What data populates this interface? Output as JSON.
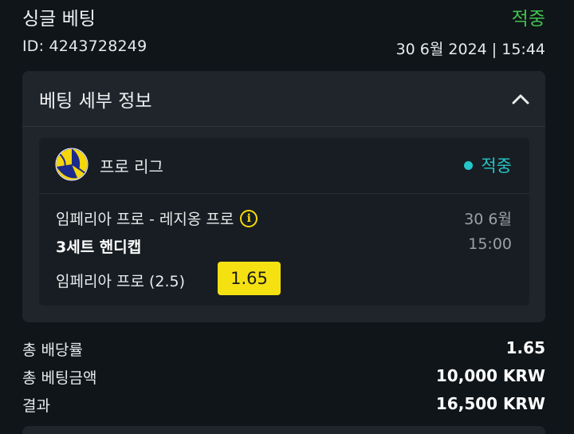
{
  "header": {
    "title": "싱글 베팅",
    "status": "적중",
    "bet_id": "ID: 4243728249",
    "datetime": "30 6월 2024 | 15:44"
  },
  "details": {
    "section_title": "베팅 세부 정보",
    "league": "프로 리그",
    "league_icon": "volleyball-icon",
    "status": "적중",
    "match": "임페리아 프로 - 레지옹 프로",
    "match_date": "30 6월",
    "market": "3세트 핸디캡",
    "match_time": "15:00",
    "selection": "임페리아 프로 (2.5)",
    "odds": "1.65"
  },
  "summary": {
    "total_odds_label": "총 배당률",
    "total_odds_value": "1.65",
    "total_stake_label": "총 베팅금액",
    "total_stake_value": "10,000 KRW",
    "result_label": "결과",
    "result_value": "16,500 KRW"
  },
  "colors": {
    "won_green": "#43c24d",
    "won_teal": "#25c6c8",
    "odds_yellow": "#f5e112",
    "background": "#0f1519",
    "card": "#1f252b"
  }
}
